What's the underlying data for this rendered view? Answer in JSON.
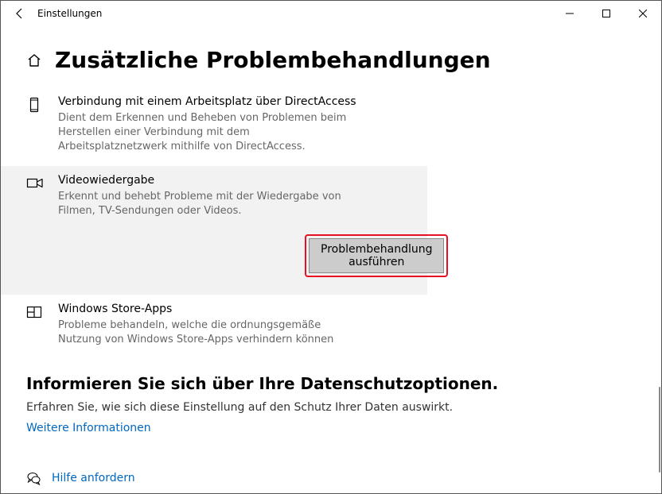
{
  "titlebar": {
    "appName": "Einstellungen"
  },
  "page": {
    "title": "Zusätzliche Problembehandlungen"
  },
  "troubleshooters": [
    {
      "title": "Verbindung mit einem Arbeitsplatz über DirectAccess",
      "desc": "Dient dem Erkennen und Beheben von Problemen beim Herstellen einer Verbindung mit dem Arbeitsplatznetzwerk mithilfe von DirectAccess."
    },
    {
      "title": "Videowiedergabe",
      "desc": "Erkennt und behebt Probleme mit der Wiedergabe von Filmen, TV-Sendungen oder Videos.",
      "runLabel": "Problembehandlung ausführen"
    },
    {
      "title": "Windows Store-Apps",
      "desc": "Probleme behandeln, welche die ordnungsgemäße Nutzung von Windows Store-Apps verhindern können"
    }
  ],
  "privacy": {
    "title": "Informieren Sie sich über Ihre Datenschutzoptionen.",
    "desc": "Erfahren Sie, wie sich diese Einstellung auf den Schutz Ihrer Daten auswirkt.",
    "link": "Weitere Informationen"
  },
  "help": {
    "link": "Hilfe anfordern"
  }
}
